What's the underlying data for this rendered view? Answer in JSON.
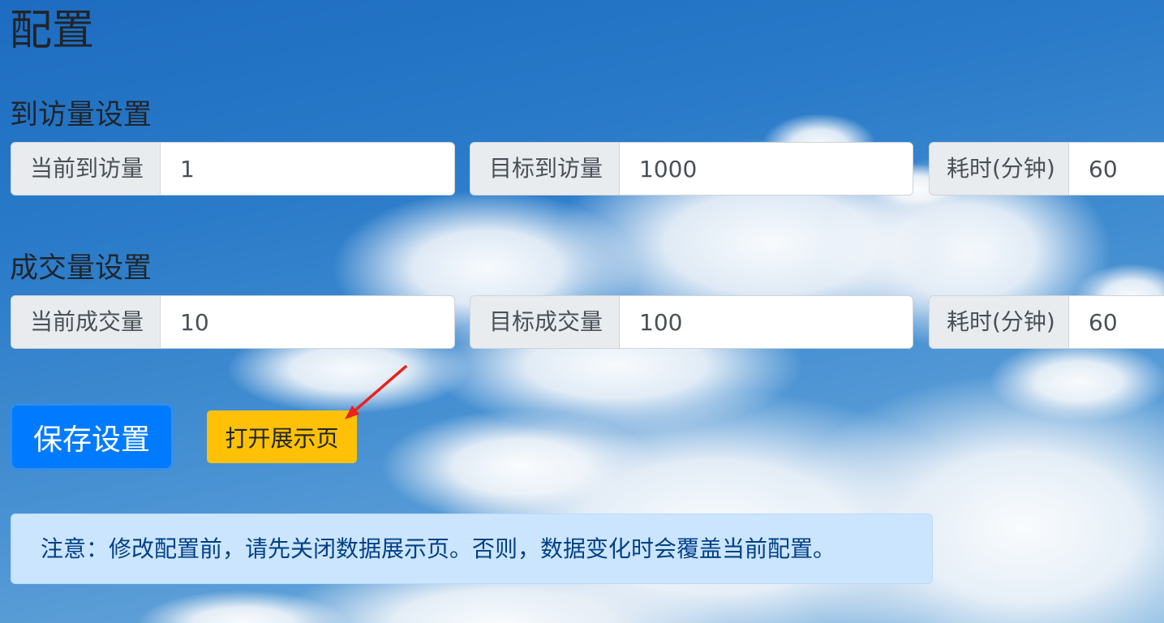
{
  "page": {
    "title": "配置"
  },
  "visit": {
    "heading": "到访量设置",
    "current": {
      "label": "当前到访量",
      "value": "1"
    },
    "target": {
      "label": "目标到访量",
      "value": "1000"
    },
    "duration": {
      "label": "耗时(分钟)",
      "value": "60"
    }
  },
  "deal": {
    "heading": "成交量设置",
    "current": {
      "label": "当前成交量",
      "value": "10"
    },
    "target": {
      "label": "目标成交量",
      "value": "100"
    },
    "duration": {
      "label": "耗时(分钟)",
      "value": "60"
    }
  },
  "actions": {
    "save_label": "保存设置",
    "open_display_label": "打开展示页"
  },
  "alert": {
    "text": "注意：修改配置前，请先关闭数据展示页。否则，数据变化时会覆盖当前配置。"
  },
  "colors": {
    "primary": "#007bff",
    "warning": "#ffc107",
    "alert_bg": "#cce5ff",
    "alert_border": "#b8daff",
    "alert_text": "#004085",
    "annotation": "#e8231c"
  }
}
